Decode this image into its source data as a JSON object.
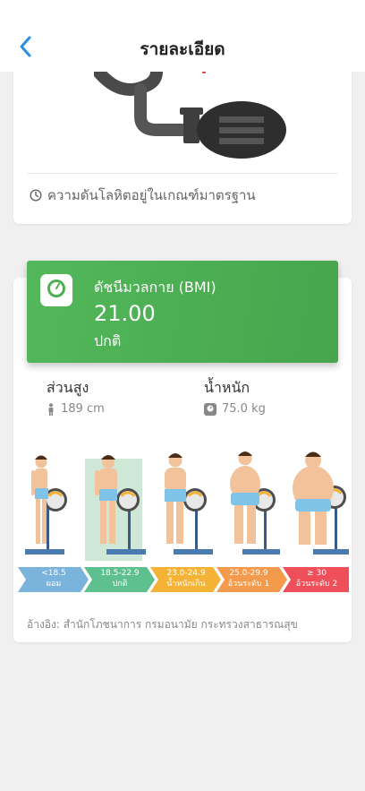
{
  "header": {
    "title": "รายละเอียด"
  },
  "blood_pressure": {
    "status": "ความดันโลหิตอยู่ในเกณฑ์มาตรฐาน"
  },
  "bmi": {
    "title": "ดัชนีมวลกาย (BMI)",
    "value": "21.00",
    "category": "ปกติ"
  },
  "metrics": {
    "height_label": "ส่วนสูง",
    "height_value": "189 cm",
    "weight_label": "น้ำหนัก",
    "weight_value": "75.0 kg"
  },
  "bmi_scale": [
    {
      "range": "<18.5",
      "label": "ผอม",
      "color": "#7ab3dc"
    },
    {
      "range": "18.5-22.9",
      "label": "ปกติ",
      "color": "#5fc08f"
    },
    {
      "range": "23.0-24.9",
      "label": "น้ำหนักเกิน",
      "color": "#f5b335"
    },
    {
      "range": "25.0-29.9",
      "label": "อ้วนระดับ 1",
      "color": "#f39a4c"
    },
    {
      "range": "≥ 30",
      "label": "อ้วนระดับ 2",
      "color": "#ef4f59"
    }
  ],
  "selected_index": 1,
  "reference": "อ้างอิง: สำนักโภชนาการ กรมอนามัย กระทรวงสาธารณสุข",
  "colors": {
    "accent": "#2a8fe0",
    "bmi_green": "#4caf50"
  }
}
